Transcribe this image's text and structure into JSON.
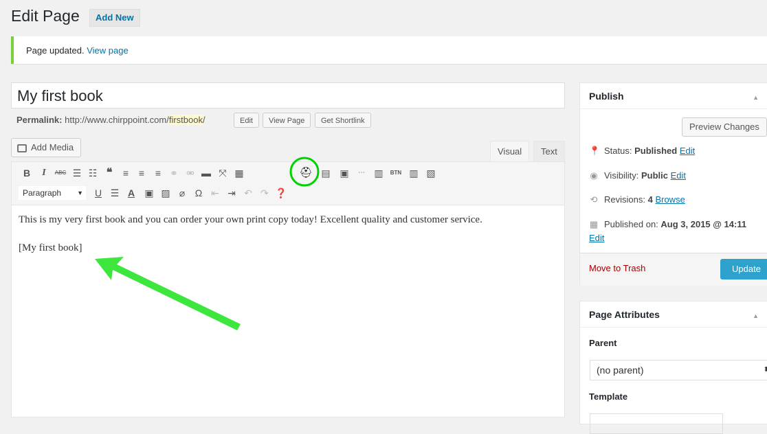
{
  "header": {
    "title": "Edit Page",
    "add_new": "Add New"
  },
  "notice": {
    "text": "Page updated.",
    "link": "View page"
  },
  "post": {
    "title": "My first book"
  },
  "permalink": {
    "label": "Permalink:",
    "base": "http://www.chirppoint.com/",
    "slug": "firstbook",
    "trail": "/",
    "edit": "Edit",
    "view": "View Page",
    "shortlink": "Get Shortlink"
  },
  "editor": {
    "add_media": "Add Media",
    "tabs": {
      "visual": "Visual",
      "text": "Text"
    },
    "format": "Paragraph",
    "content_line1": "This is my very first book and you can order your own print copy today! Excellent quality and customer service.",
    "content_line2": "[My first book]"
  },
  "publish": {
    "title": "Publish",
    "preview": "Preview Changes",
    "status_label": "Status:",
    "status_value": "Published",
    "visibility_label": "Visibility:",
    "visibility_value": "Public",
    "revisions_label": "Revisions:",
    "revisions_value": "4",
    "browse": "Browse",
    "published_on_label": "Published on:",
    "published_on_value": "Aug 3, 2015 @ 14:11",
    "edit": "Edit",
    "trash": "Move to Trash",
    "update": "Update"
  },
  "attributes": {
    "title": "Page Attributes",
    "parent_label": "Parent",
    "parent_value": "(no parent)",
    "template_label": "Template"
  },
  "colors": {
    "accent": "#0073aa",
    "update": "#2ea2cc",
    "notice": "#7ad03a",
    "highlight": "#00d100"
  }
}
